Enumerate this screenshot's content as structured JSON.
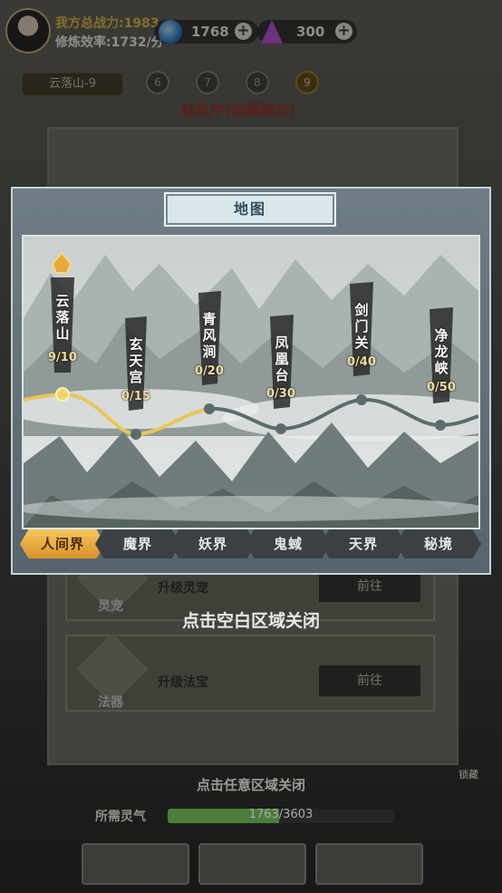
{
  "header": {
    "total_power": "我方总战力:1983",
    "cultivation_rate": "修炼效率:1732/分",
    "spirit_stones": "1768",
    "crystals": "300",
    "plus": "+"
  },
  "stage": {
    "current_area": "云落山-9",
    "dots": [
      "6",
      "7",
      "8",
      "9"
    ],
    "status": "挂机中(些题锁定)"
  },
  "background": {
    "card1_icon_label": "灵宠",
    "card1_title": "升级灵宠",
    "card1_button": "前往",
    "card2_icon_label": "法器",
    "card2_title": "升级法宝",
    "card2_button": "前往",
    "close_hint": "点击空白区域关闭",
    "close_hint_any": "点击任意区域关闭",
    "lingqi_label": "所需灵气",
    "lingqi_value": "1763/3603",
    "lingqi_progress": 0.49,
    "side_label": "锁藏"
  },
  "map_dialog": {
    "title": "地图",
    "locations": [
      {
        "name": "云落山",
        "progress": "9/10",
        "current": true
      },
      {
        "name": "玄天宫",
        "progress": "0/15"
      },
      {
        "name": "青风涧",
        "progress": "0/20"
      },
      {
        "name": "凤凰台",
        "progress": "0/30"
      },
      {
        "name": "剑门关",
        "progress": "0/40"
      },
      {
        "name": "净龙峡",
        "progress": "0/50"
      }
    ],
    "tabs": [
      {
        "label": "人间界",
        "active": true
      },
      {
        "label": "魔界"
      },
      {
        "label": "妖界"
      },
      {
        "label": "鬼蜮"
      },
      {
        "label": "天界"
      },
      {
        "label": "秘境"
      }
    ]
  },
  "colors": {
    "path_done": "#e8c65a",
    "path_todo": "#5b6c6c",
    "tab_active": "#f1b94b"
  }
}
